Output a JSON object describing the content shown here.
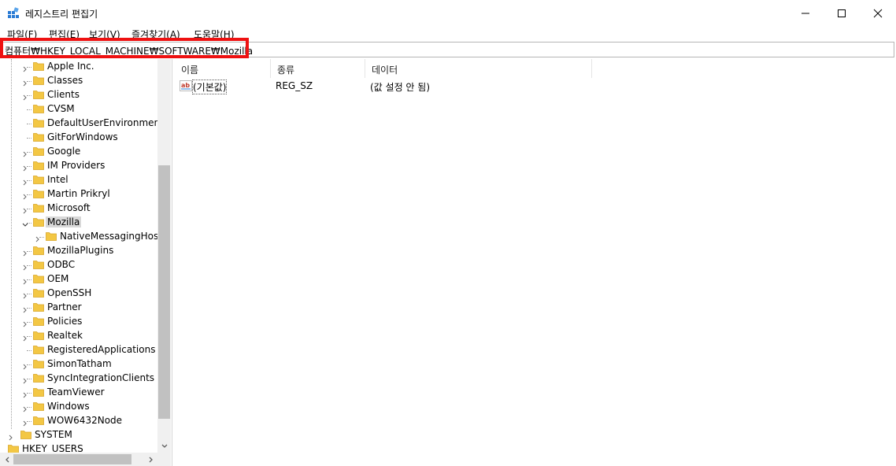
{
  "window": {
    "title": "레지스트리 편집기"
  },
  "menu": [
    "파일(F)",
    "편집(E)",
    "보기(V)",
    "즐겨찾기(A)",
    "도움말(H)"
  ],
  "address": {
    "path": "컴퓨터₩HKEY_LOCAL_MACHINE₩SOFTWARE₩Mozilla"
  },
  "tree": {
    "items": [
      {
        "label": "Apple Inc.",
        "expandable": true
      },
      {
        "label": "Classes",
        "expandable": true
      },
      {
        "label": "Clients",
        "expandable": true
      },
      {
        "label": "CVSM",
        "expandable": false
      },
      {
        "label": "DefaultUserEnvironment",
        "expandable": false
      },
      {
        "label": "GitForWindows",
        "expandable": false
      },
      {
        "label": "Google",
        "expandable": true
      },
      {
        "label": "IM Providers",
        "expandable": true
      },
      {
        "label": "Intel",
        "expandable": true
      },
      {
        "label": "Martin Prikryl",
        "expandable": true
      },
      {
        "label": "Microsoft",
        "expandable": true
      },
      {
        "label": "Mozilla",
        "expandable": true,
        "expanded": true,
        "selected": true
      },
      {
        "label": "NativeMessagingHosts",
        "expandable": true,
        "child": true
      },
      {
        "label": "MozillaPlugins",
        "expandable": true
      },
      {
        "label": "ODBC",
        "expandable": true
      },
      {
        "label": "OEM",
        "expandable": true
      },
      {
        "label": "OpenSSH",
        "expandable": true
      },
      {
        "label": "Partner",
        "expandable": true
      },
      {
        "label": "Policies",
        "expandable": true
      },
      {
        "label": "Realtek",
        "expandable": true
      },
      {
        "label": "RegisteredApplications",
        "expandable": false
      },
      {
        "label": "SimonTatham",
        "expandable": true
      },
      {
        "label": "SyncIntegrationClients",
        "expandable": true
      },
      {
        "label": "TeamViewer",
        "expandable": true
      },
      {
        "label": "Windows",
        "expandable": true
      },
      {
        "label": "WOW6432Node",
        "expandable": true
      }
    ],
    "system": "SYSTEM",
    "hkey_users": "HKEY_USERS"
  },
  "list": {
    "columns": [
      "이름",
      "종류",
      "데이터"
    ],
    "rows": [
      {
        "name": "(기본값)",
        "type": "REG_SZ",
        "data": "(값 설정 안 됨)",
        "icon": "ab-string-icon"
      }
    ]
  },
  "colors": {
    "highlight": "#ee1111",
    "folder": "#f3c744",
    "selected": "#d9d9d9"
  }
}
